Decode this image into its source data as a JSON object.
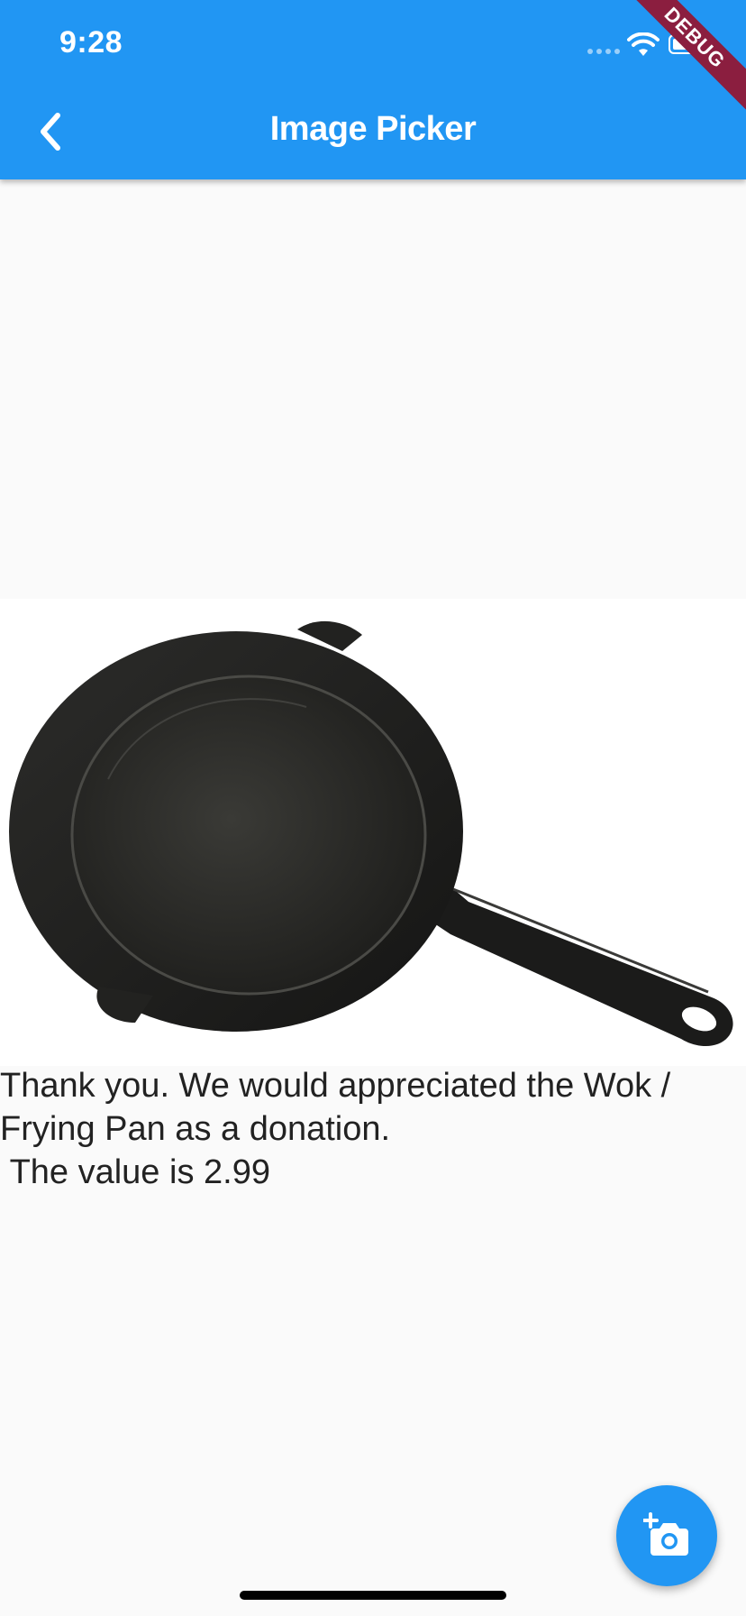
{
  "status_bar": {
    "time": "9:28"
  },
  "debug_banner": "DEBUG",
  "app_bar": {
    "title": "Image Picker",
    "back_icon": "chevron-left-icon"
  },
  "content": {
    "image_subject": "frying-pan",
    "message": "Thank you. We would appreciated the Wok / Frying Pan as a donation.\n The value is 2.99"
  },
  "fab": {
    "icon": "add-a-photo-icon"
  },
  "colors": {
    "primary": "#2196f3",
    "background": "#fafafa",
    "debug_ribbon": "#8b1e3f",
    "text": "#222222"
  }
}
